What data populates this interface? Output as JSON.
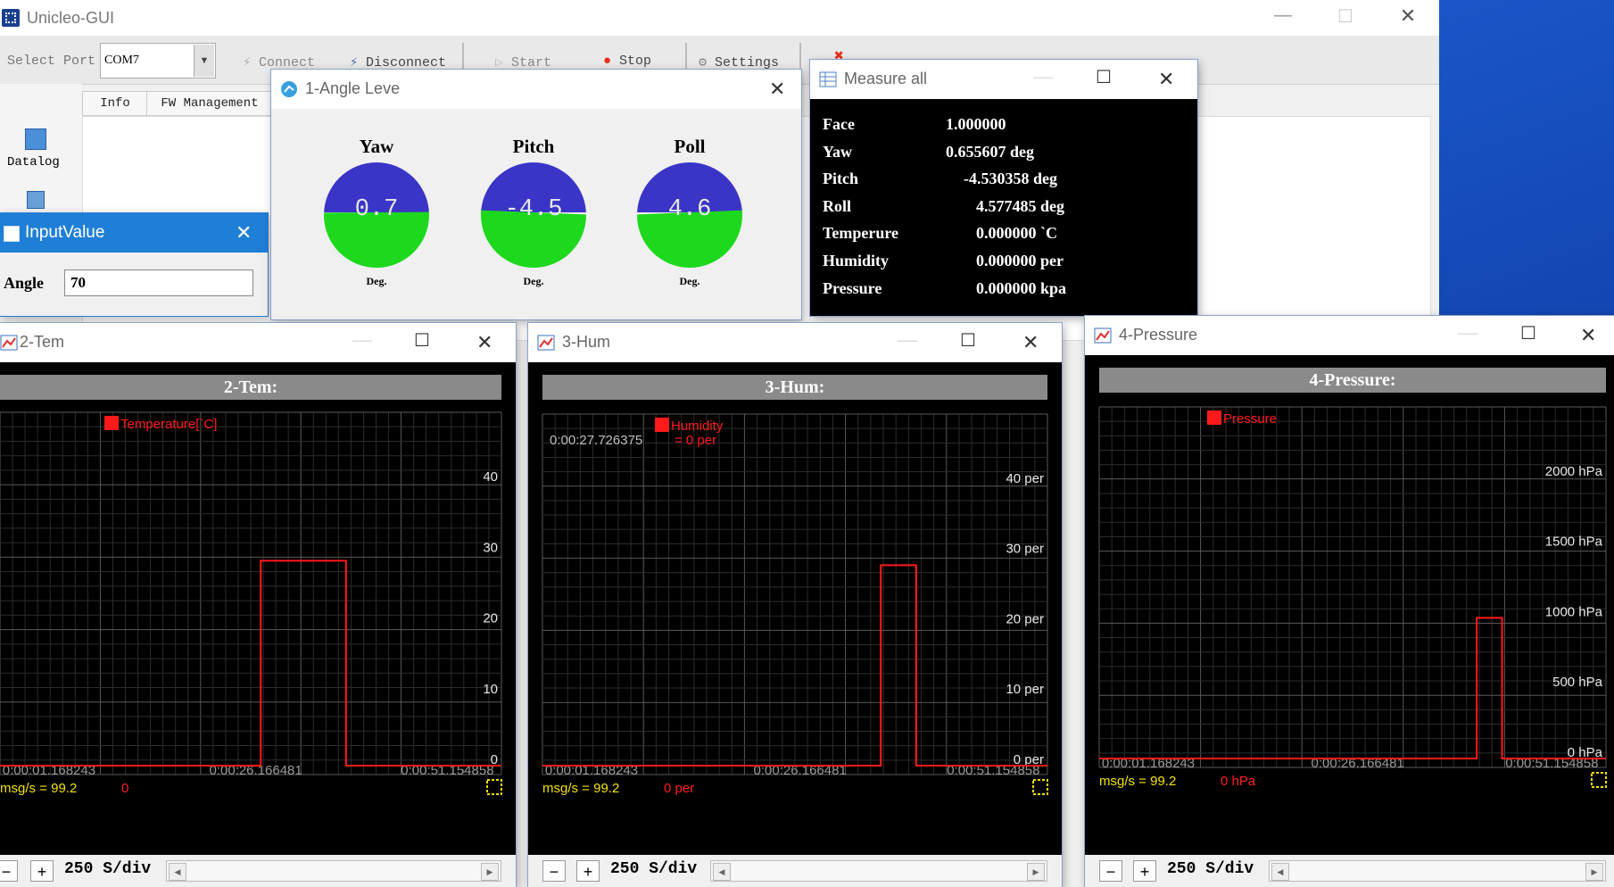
{
  "main": {
    "title": "Unicleo-GUI",
    "toolbar": {
      "select_port_label": "Select Port",
      "port_value": "COM7",
      "connect": "Connect",
      "disconnect": "Disconnect",
      "start": "Start",
      "stop": "Stop",
      "settings": "Settings"
    },
    "tabs": [
      "Info",
      "FW Management"
    ],
    "sidebar": {
      "datalog": "Datalog"
    }
  },
  "input_value": {
    "title": "InputValue",
    "label": "Angle",
    "value": "70"
  },
  "angle_level": {
    "title": "1-Angle Leve",
    "gauges": [
      {
        "label": "Yaw",
        "value": "0.7",
        "unit": "Deg.",
        "tilt": 0.7
      },
      {
        "label": "Pitch",
        "value": "-4.5",
        "unit": "Deg.",
        "tilt": -4.5
      },
      {
        "label": "Poll",
        "value": "4.6",
        "unit": "Deg.",
        "tilt": 4.6
      }
    ],
    "colors": {
      "upper": "#3a35c7",
      "lower": "#1ed81e"
    }
  },
  "measure_all": {
    "title": "Measure all",
    "rows": [
      {
        "name": "Face",
        "value": "1.000000"
      },
      {
        "name": "Yaw",
        "value": "0.655607 deg"
      },
      {
        "name": "Pitch",
        "value": "-4.530358 deg"
      },
      {
        "name": "Roll",
        "value": "4.577485 deg"
      },
      {
        "name": "Temperure",
        "value": "0.000000 `C"
      },
      {
        "name": "Humidity",
        "value": "0.000000 per"
      },
      {
        "name": "Pressure",
        "value": "0.000000 kpa"
      }
    ]
  },
  "chart_data": [
    {
      "type": "line",
      "title": "2-Tem:",
      "window_title": "2-Tem",
      "legend": "Temperature[`C]",
      "yticks": [
        "40",
        "30",
        "20",
        "10",
        "0"
      ],
      "ytick_values": [
        40,
        30,
        20,
        10,
        0
      ],
      "ylim": [
        0,
        50
      ],
      "xticks": [
        "0:00:01.168243",
        "0:00:26.166481",
        "0:00:51.154858"
      ],
      "msgs": "msg/s = 99.2",
      "current": "0",
      "sdiv": "250 S/div",
      "x": [
        0,
        0.52,
        0.52,
        0.53,
        0.53,
        0.69,
        0.69,
        1.0
      ],
      "y": [
        0,
        0,
        29,
        29,
        29,
        29,
        0,
        0
      ],
      "color": "#ff1a1a"
    },
    {
      "type": "line",
      "title": "3-Hum:",
      "window_title": "3-Hum",
      "legend": "Humidity",
      "legend2": "= 0 per",
      "time_label": "0:00:27.726375",
      "yticks": [
        "40 per",
        "30 per",
        "20 per",
        "10 per",
        "0 per"
      ],
      "ytick_values": [
        40,
        30,
        20,
        10,
        0
      ],
      "ylim": [
        0,
        50
      ],
      "xticks": [
        "0:00:01.168243",
        "0:00:26.166481",
        "0:00:51.154858"
      ],
      "msgs": "msg/s = 99.2",
      "current": "0 per",
      "sdiv": "250 S/div",
      "x": [
        0,
        0.67,
        0.67,
        0.74,
        0.74,
        1.0
      ],
      "y": [
        0,
        0,
        28.5,
        28.5,
        0,
        0
      ],
      "color": "#ff1a1a"
    },
    {
      "type": "line",
      "title": "4-Pressure:",
      "window_title": "4-Pressure",
      "legend": "Pressure",
      "yticks": [
        "2000 hPa",
        "1500 hPa",
        "1000 hPa",
        "500 hPa",
        "0 hPa"
      ],
      "ytick_values": [
        2000,
        1500,
        1000,
        500,
        0
      ],
      "ylim": [
        0,
        2500
      ],
      "xticks": [
        "0:00:01.168243",
        "0:00:26.166481",
        "0:00:51.154858"
      ],
      "msgs": "msg/s = 99.2",
      "current": "0 hPa",
      "sdiv": "250 S/div",
      "x": [
        0,
        0.745,
        0.745,
        0.795,
        0.795,
        1.0
      ],
      "y": [
        0,
        0,
        1000,
        1000,
        0,
        0
      ],
      "color": "#ff1a1a"
    }
  ]
}
